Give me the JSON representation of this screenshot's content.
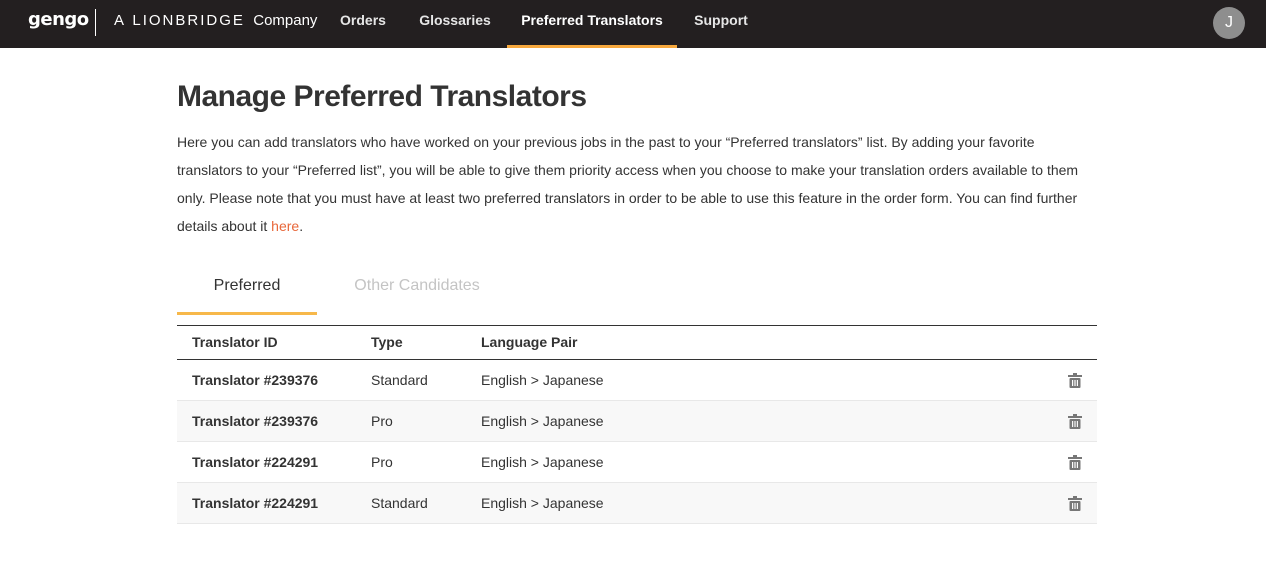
{
  "header": {
    "logo": "gengo",
    "company_prefix": "A",
    "company_brand": "LIONBRIDGE",
    "company_suffix": "Company",
    "nav": [
      {
        "label": "Orders"
      },
      {
        "label": "Glossaries"
      },
      {
        "label": "Preferred Translators",
        "active": true
      },
      {
        "label": "Support"
      }
    ],
    "avatar_initial": "J",
    "accent_color": "#f7a83d",
    "background_color": "#231f20"
  },
  "main": {
    "title": "Manage Preferred Translators",
    "description_main": "Here you can add translators who have worked on your previous jobs in the past to your “Preferred translators” list. By adding your favorite translators to your “Preferred list”, you will be able to give them priority access when you choose to make your translation orders available to them only. Please note that you must have at least two preferred translators in order to be able to use this feature in the order form. You can find further details about it ",
    "description_link": "here",
    "description_end": ".",
    "link_color": "#e8673a",
    "tabs": [
      {
        "label": "Preferred",
        "active": true
      },
      {
        "label": "Other Candidates",
        "active": false
      }
    ]
  },
  "table": {
    "columns": [
      "Translator ID",
      "Type",
      "Language Pair"
    ],
    "rows": [
      {
        "id": "Translator #239376",
        "type": "Standard",
        "language_pair": "English > Japanese",
        "action_icon": "trash-icon"
      },
      {
        "id": "Translator #239376",
        "type": "Pro",
        "language_pair": "English > Japanese",
        "action_icon": "trash-icon"
      },
      {
        "id": "Translator #224291",
        "type": "Pro",
        "language_pair": "English > Japanese",
        "action_icon": "trash-icon"
      },
      {
        "id": "Translator #224291",
        "type": "Standard",
        "language_pair": "English > Japanese",
        "action_icon": "trash-icon"
      }
    ]
  }
}
